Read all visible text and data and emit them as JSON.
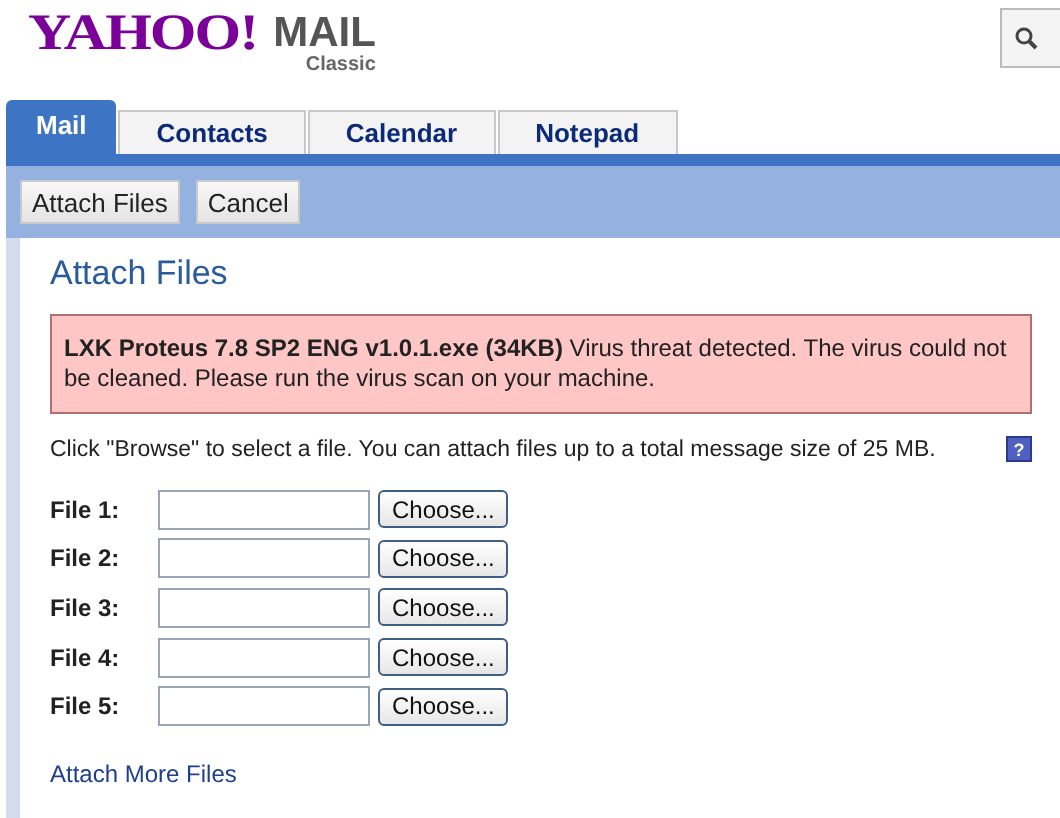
{
  "logo": {
    "brand": "YAHOO!",
    "product": "MAIL",
    "edition": "Classic"
  },
  "tabs": [
    {
      "label": "Mail",
      "selected": true
    },
    {
      "label": "Contacts",
      "selected": false
    },
    {
      "label": "Calendar",
      "selected": false
    },
    {
      "label": "Notepad",
      "selected": false
    }
  ],
  "toolbar": {
    "buttons": [
      "Attach Files",
      "Cancel"
    ]
  },
  "page": {
    "title": "Attach Files",
    "alert": {
      "file": "LXK Proteus 7.8 SP2 ENG v1.0.1.exe (34KB)",
      "message": "Virus threat detected. The virus could not be cleaned. Please run the virus scan on your machine."
    },
    "instructions": "Click \"Browse\" to select a file. You can attach files up to a total message size of 25 MB.",
    "help_icon": "?",
    "files": [
      {
        "label": "File 1:",
        "button": "Choose..."
      },
      {
        "label": "File 2:",
        "button": "Choose..."
      },
      {
        "label": "File 3:",
        "button": "Choose..."
      },
      {
        "label": "File 4:",
        "button": "Choose..."
      },
      {
        "label": "File 5:",
        "button": "Choose..."
      }
    ],
    "more_link": "Attach More Files"
  }
}
